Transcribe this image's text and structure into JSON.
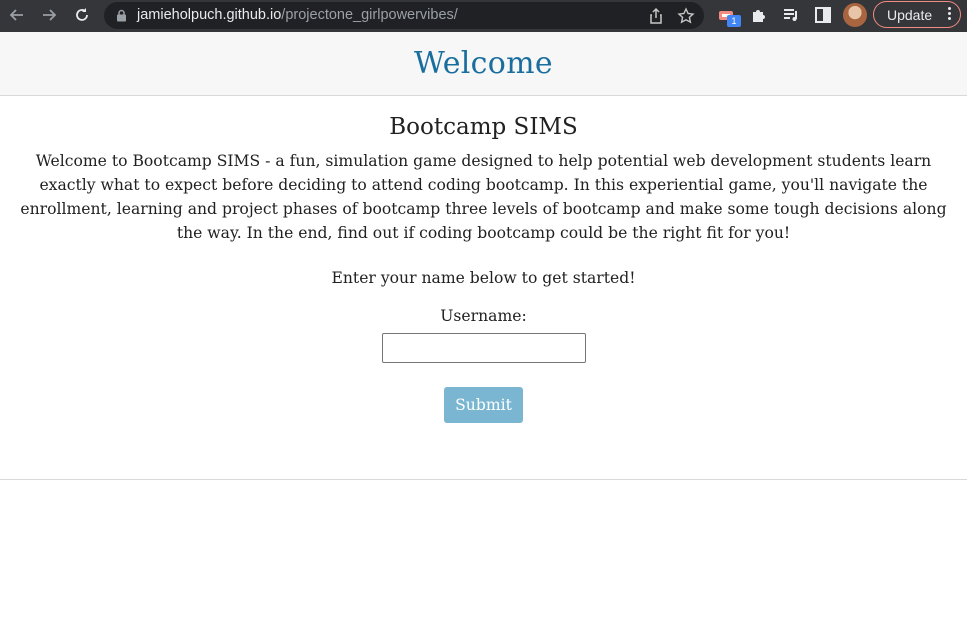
{
  "browser": {
    "url_host": "jamieholpuch.github.io",
    "url_path": "/projectone_girlpowervibes/",
    "extension_badge": "1",
    "update_label": "Update",
    "icons": [
      "back-arrow-icon",
      "forward-arrow-icon",
      "reload-icon",
      "lock-icon",
      "share-icon",
      "star-icon",
      "cast-extension-icon",
      "puzzle-icon",
      "media-icon",
      "side-panel-icon",
      "kebab-menu-icon"
    ]
  },
  "page": {
    "header_title": "Welcome",
    "game_title": "Bootcamp SIMS",
    "intro": "Welcome to Bootcamp SIMS - a fun, simulation game designed to help potential web development students learn exactly what to expect before deciding to attend coding bootcamp. In this experiential game, you'll navigate the enrollment, learning and project phases of bootcamp three levels of bootcamp and make some tough decisions along the way. In the end, find out if coding bootcamp could be the right fit for you!",
    "prompt": "Enter your name below to get started!",
    "username_label": "Username:",
    "username_value": "",
    "submit_label": "Submit"
  },
  "colors": {
    "header_title": "#1a6e9e",
    "submit_bg": "#7ab6d1",
    "chrome_bg": "#35363a"
  }
}
